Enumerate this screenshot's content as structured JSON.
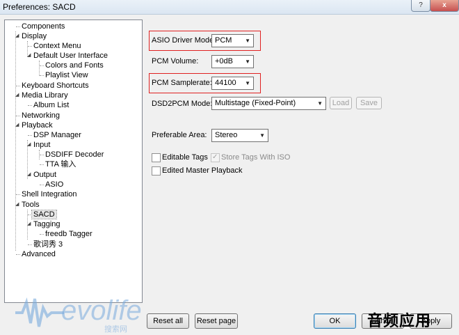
{
  "window": {
    "title": "Preferences: SACD",
    "help_label": "?",
    "close_label": "x"
  },
  "tree": [
    {
      "label": "Components"
    },
    {
      "label": "Display"
    },
    {
      "label": "Context Menu"
    },
    {
      "label": "Default User Interface"
    },
    {
      "label": "Colors and Fonts"
    },
    {
      "label": "Playlist View"
    },
    {
      "label": "Keyboard Shortcuts"
    },
    {
      "label": "Media Library"
    },
    {
      "label": "Album List"
    },
    {
      "label": "Networking"
    },
    {
      "label": "Playback"
    },
    {
      "label": "DSP Manager"
    },
    {
      "label": "Input"
    },
    {
      "label": "DSDIFF Decoder"
    },
    {
      "label": "TTA 输入"
    },
    {
      "label": "Output"
    },
    {
      "label": "ASIO"
    },
    {
      "label": "Shell Integration"
    },
    {
      "label": "Tools"
    },
    {
      "label": "SACD"
    },
    {
      "label": "Tagging"
    },
    {
      "label": "freedb Tagger"
    },
    {
      "label": "歌词秀 3"
    },
    {
      "label": "Advanced"
    }
  ],
  "settings": {
    "asio_driver_mode": {
      "label": "ASIO Driver Mode:",
      "value": "PCM"
    },
    "pcm_volume": {
      "label": "PCM Volume:",
      "value": "+0dB"
    },
    "pcm_samplerate": {
      "label": "PCM Samplerate:",
      "value": "44100"
    },
    "dsd2pcm_mode": {
      "label": "DSD2PCM Mode:",
      "value": "Multistage (Fixed-Point)",
      "load_label": "Load",
      "save_label": "Save"
    },
    "preferable_area": {
      "label": "Preferable Area:",
      "value": "Stereo"
    },
    "editable_tags": {
      "label": "Editable Tags"
    },
    "store_tags_with_iso": {
      "label": "Store Tags With ISO"
    },
    "edited_master_playback": {
      "label": "Edited Master Playback"
    }
  },
  "buttons": {
    "reset_all": "Reset all",
    "reset_page": "Reset page",
    "ok": "OK",
    "cancel": "Cancel",
    "apply": "Apply"
  },
  "watermarks": {
    "evolife": "evolife",
    "evolife_sub": "搜索网",
    "corner": "音频应用"
  },
  "colors": {
    "highlight_box": "#e02020",
    "selected_node_bg": "#e6e6e6"
  },
  "state": {
    "selected_node": "SACD",
    "editable_tags_checked": false,
    "store_tags_with_iso_checked": true,
    "store_tags_with_iso_enabled": false,
    "edited_master_playback_checked": false,
    "load_enabled": false,
    "save_enabled": false
  }
}
